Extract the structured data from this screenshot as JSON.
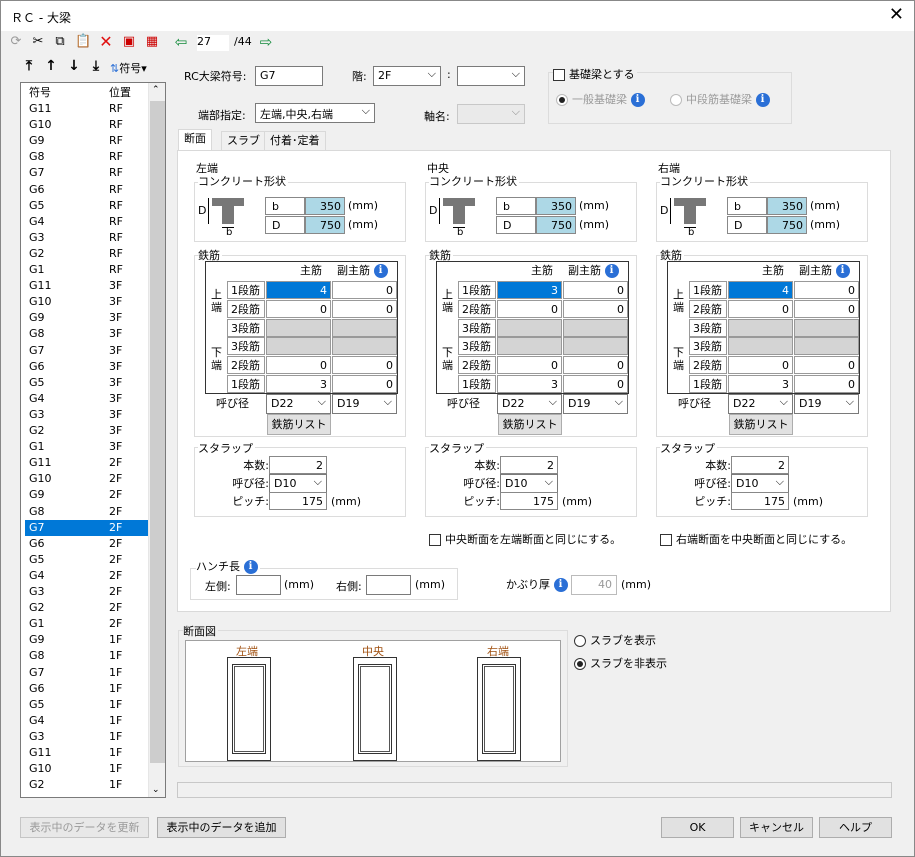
{
  "window": {
    "title": "ＲＣ - 大梁",
    "close": "✕"
  },
  "toolbar": {
    "page_current": "27",
    "page_total": "/44"
  },
  "sort_toolbar": {
    "label": "符号"
  },
  "list": {
    "headers": [
      "符号",
      "位置"
    ],
    "rows": [
      [
        "G11",
        "RF"
      ],
      [
        "G10",
        "RF"
      ],
      [
        "G9",
        "RF"
      ],
      [
        "G8",
        "RF"
      ],
      [
        "G7",
        "RF"
      ],
      [
        "G6",
        "RF"
      ],
      [
        "G5",
        "RF"
      ],
      [
        "G4",
        "RF"
      ],
      [
        "G3",
        "RF"
      ],
      [
        "G2",
        "RF"
      ],
      [
        "G1",
        "RF"
      ],
      [
        "G11",
        "3F"
      ],
      [
        "G10",
        "3F"
      ],
      [
        "G9",
        "3F"
      ],
      [
        "G8",
        "3F"
      ],
      [
        "G7",
        "3F"
      ],
      [
        "G6",
        "3F"
      ],
      [
        "G5",
        "3F"
      ],
      [
        "G4",
        "3F"
      ],
      [
        "G3",
        "3F"
      ],
      [
        "G2",
        "3F"
      ],
      [
        "G1",
        "3F"
      ],
      [
        "G11",
        "2F"
      ],
      [
        "G10",
        "2F"
      ],
      [
        "G9",
        "2F"
      ],
      [
        "G8",
        "2F"
      ],
      [
        "G7",
        "2F"
      ],
      [
        "G6",
        "2F"
      ],
      [
        "G5",
        "2F"
      ],
      [
        "G4",
        "2F"
      ],
      [
        "G3",
        "2F"
      ],
      [
        "G2",
        "2F"
      ],
      [
        "G1",
        "2F"
      ],
      [
        "G9",
        "1F"
      ],
      [
        "G8",
        "1F"
      ],
      [
        "G7",
        "1F"
      ],
      [
        "G6",
        "1F"
      ],
      [
        "G5",
        "1F"
      ],
      [
        "G4",
        "1F"
      ],
      [
        "G3",
        "1F"
      ],
      [
        "G11",
        "1F"
      ],
      [
        "G10",
        "1F"
      ],
      [
        "G2",
        "1F"
      ]
    ],
    "selected_index": 26
  },
  "form": {
    "symbol_label": "RC大梁符号:",
    "symbol_value": "G7",
    "floor_label": "階:",
    "floor_value": "2F",
    "floor2_value": "",
    "end_label": "端部指定:",
    "end_value": "左端,中央,右端",
    "axis_label": "軸名:",
    "axis_value": "",
    "foundation_label": "基礎梁とする",
    "radio_general": "一般基礎梁",
    "radio_mid": "中段筋基礎梁"
  },
  "tabs": [
    "断面",
    "スラブ",
    "付着･定着"
  ],
  "sections": [
    {
      "title": "左端",
      "sub": "コンクリート形状",
      "b": "350",
      "D": "750",
      "r": [
        [
          "4",
          "0"
        ],
        [
          "0",
          "0"
        ],
        [
          "",
          ""
        ],
        [
          "",
          ""
        ],
        [
          "0",
          "0"
        ],
        [
          "3",
          "0"
        ]
      ],
      "d1": "D22",
      "d2": "D19",
      "count": "2",
      "dia": "D10",
      "pitch": "175"
    },
    {
      "title": "中央",
      "sub": "コンクリート形状",
      "b": "350",
      "D": "750",
      "r": [
        [
          "3",
          "0"
        ],
        [
          "0",
          "0"
        ],
        [
          "",
          ""
        ],
        [
          "",
          ""
        ],
        [
          "0",
          "0"
        ],
        [
          "3",
          "0"
        ]
      ],
      "d1": "D22",
      "d2": "D19",
      "count": "2",
      "dia": "D10",
      "pitch": "175"
    },
    {
      "title": "右端",
      "sub": "コンクリート形状",
      "b": "350",
      "D": "750",
      "r": [
        [
          "4",
          "0"
        ],
        [
          "0",
          "0"
        ],
        [
          "",
          ""
        ],
        [
          "",
          ""
        ],
        [
          "0",
          "0"
        ],
        [
          "3",
          "0"
        ]
      ],
      "d1": "D22",
      "d2": "D19",
      "count": "2",
      "dia": "D10",
      "pitch": "175"
    }
  ],
  "labels": {
    "b": "b",
    "D": "D",
    "mm": "(mm)",
    "rebar": "鉄筋",
    "main": "主筋",
    "sub_main": "副主筋",
    "row1": "1段筋",
    "row2": "2段筋",
    "row3": "3段筋",
    "top": "上\n端",
    "bottom": "下\n端",
    "call": "呼び径",
    "rebar_list": "鉄筋リスト",
    "stirrup": "スタラップ",
    "count": "本数:",
    "dia": "呼び径:",
    "pitch": "ピッチ:",
    "same_mid": "中央断面を左端断面と同じにする。",
    "same_right": "右端断面を中央断面と同じにする。",
    "haunch": "ハンチ長",
    "left_side": "左側:",
    "right_side": "右側:",
    "cover": "かぶり厚",
    "cover_value": "40",
    "section_diagram": "断面図",
    "diag_left": "左端",
    "diag_mid": "中央",
    "diag_right": "右端",
    "show_slab": "スラブを表示",
    "hide_slab": "スラブを非表示"
  },
  "buttons": {
    "update": "表示中のデータを更新",
    "add": "表示中のデータを追加",
    "ok": "OK",
    "cancel": "キャンセル",
    "help": "ヘルプ"
  }
}
